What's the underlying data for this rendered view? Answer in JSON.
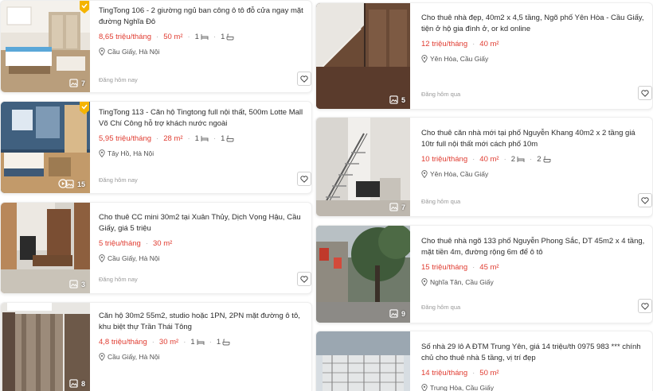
{
  "listings_left": [
    {
      "title": "TingTong 106 - 2 giường ngủ ban công ô tô đỗ cửa ngay mặt đường Nghĩa Đô",
      "price": "8,65 triệu/tháng",
      "area": "50 m²",
      "bedrooms": "1",
      "bathrooms": "1",
      "location": "Cầu Giấy, Hà Nội",
      "posted": "Đăng hôm nay",
      "photo_count": "7",
      "has_video": false,
      "has_badge": true
    },
    {
      "title": "TingTong 113 - Căn hộ Tingtong full nội thất, 500m Lotte Mall Võ Chí Công hỗ trợ khách nước ngoài",
      "price": "5,95 triệu/tháng",
      "area": "28 m²",
      "bedrooms": "1",
      "bathrooms": "1",
      "location": "Tây Hồ, Hà Nội",
      "posted": "Đăng hôm nay",
      "photo_count": "15",
      "has_video": true,
      "has_badge": true
    },
    {
      "title": "Cho thuê CC mini 30m2 tại Xuân Thủy, Dịch Vọng Hậu, Cầu Giấy, giá 5 triệu",
      "price": "5 triệu/tháng",
      "area": "30 m²",
      "bedrooms": "",
      "bathrooms": "",
      "location": "Cầu Giấy, Hà Nội",
      "posted": "Đăng hôm nay",
      "photo_count": "3",
      "has_video": false,
      "has_badge": false
    },
    {
      "title": "Căn hộ 30m2 55m2, studio hoặc 1PN, 2PN mặt đường ô tô, khu biệt thự Trần Thái Tông",
      "price": "4,8 triệu/tháng",
      "area": "30 m²",
      "bedrooms": "1",
      "bathrooms": "1",
      "location": "Cầu Giấy, Hà Nội",
      "posted": "",
      "photo_count": "8",
      "has_video": false,
      "has_badge": false
    }
  ],
  "listings_right": [
    {
      "title": "Cho thuê nhà đẹp, 40m2 x 4,5 tầng, Ngõ phố Yên Hòa - Cầu Giấy, tiện ở hộ gia đình ở, or kd online",
      "price": "12 triệu/tháng",
      "area": "40 m²",
      "bedrooms": "",
      "bathrooms": "",
      "location": "Yên Hòa, Cầu Giấy",
      "posted": "Đăng hôm qua",
      "photo_count": "5"
    },
    {
      "title": "Cho thuê căn nhà mới tại phố Nguyễn Khang 40m2 x 2 tầng giá 10tr full nội thất mới cách phố 10m",
      "price": "10 triệu/tháng",
      "area": "40 m²",
      "bedrooms": "2",
      "bathrooms": "2",
      "location": "Yên Hòa, Cầu Giấy",
      "posted": "Đăng hôm qua",
      "photo_count": "7"
    },
    {
      "title": "Cho thuê nhà ngõ 133 phố Nguyễn Phong Sắc, DT 45m2 x 4 tầng, mặt tiền 4m, đường rộng 6m để ô tô",
      "price": "15 triệu/tháng",
      "area": "45 m²",
      "bedrooms": "",
      "bathrooms": "",
      "location": "Nghĩa Tân, Cầu Giấy",
      "posted": "Đăng hôm qua",
      "photo_count": "9"
    },
    {
      "title": "Số nhà 29 lô A ĐTM Trung Yên, giá 14 triệu/th 0975 983 *** chính chủ cho thuê nhà 5 tầng, vị trí đẹp",
      "price": "14 triệu/tháng",
      "area": "50 m²",
      "bedrooms": "",
      "bathrooms": "",
      "location": "Trung Hòa, Cầu Giấy",
      "posted": "",
      "photo_count": ""
    }
  ],
  "colors": {
    "price": "#e03c31",
    "text": "#2c2c2c",
    "muted": "#999999",
    "border": "#cfcfcf"
  },
  "icons": {
    "photo": "image-icon",
    "video": "play-icon",
    "bed": "bed-icon",
    "bath": "bath-icon",
    "location": "map-pin-icon",
    "favorite": "heart-icon",
    "badge": "verified-badge-icon"
  }
}
